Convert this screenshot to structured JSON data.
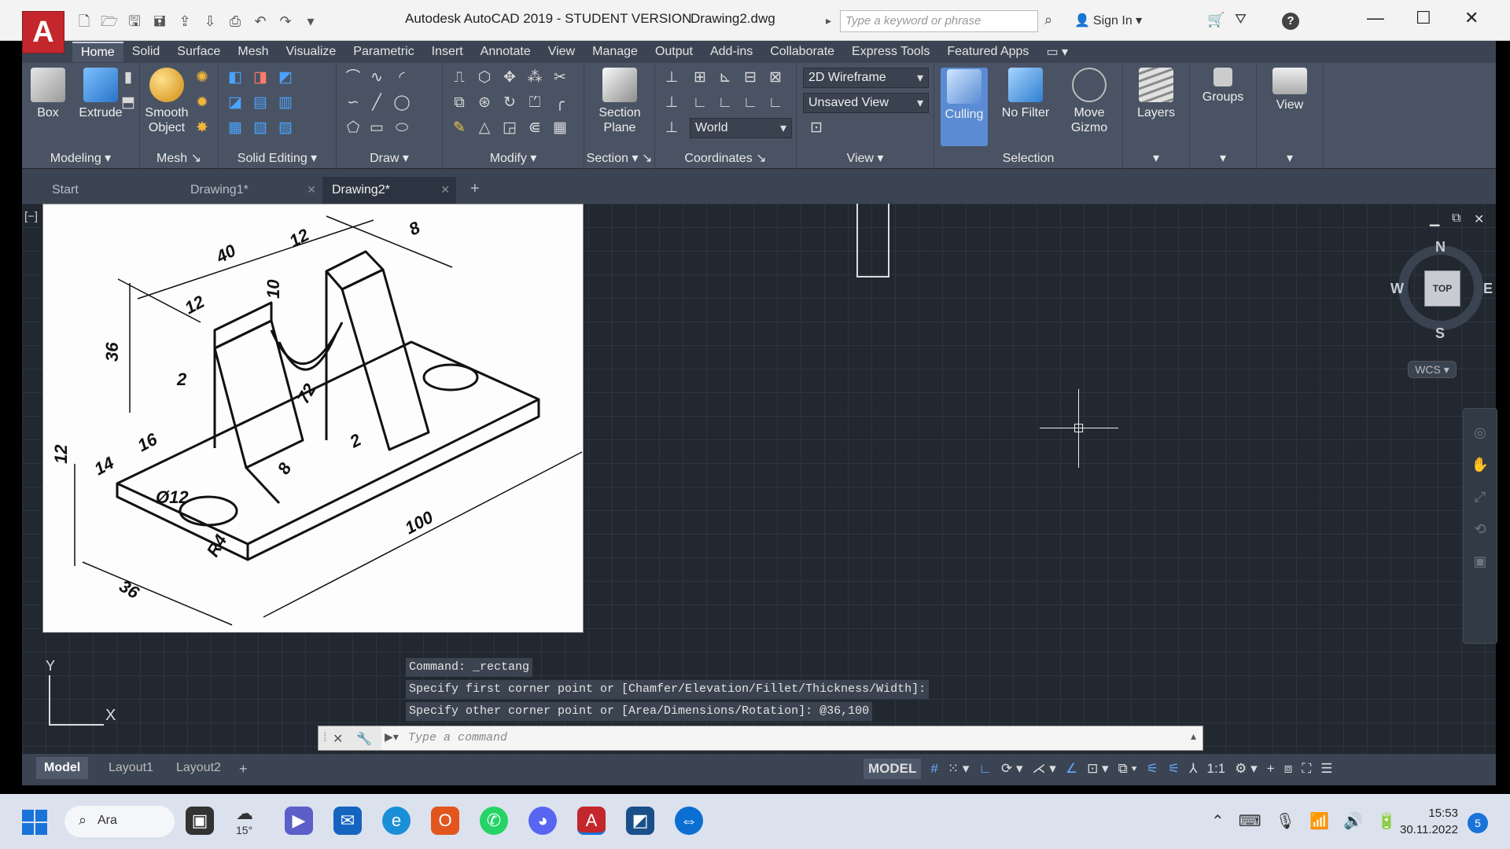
{
  "titlebar": {
    "app_title": "Autodesk AutoCAD 2019 - STUDENT VERSION",
    "file_title": "Drawing2.dwg",
    "search_placeholder": "Type a keyword or phrase",
    "sign_in": "Sign In",
    "logo_letter": "A"
  },
  "ribbon_tabs": [
    "Home",
    "Solid",
    "Surface",
    "Mesh",
    "Visualize",
    "Parametric",
    "Insert",
    "Annotate",
    "View",
    "Manage",
    "Output",
    "Add-ins",
    "Collaborate",
    "Express Tools",
    "Featured Apps"
  ],
  "ribbon": {
    "modeling": {
      "title": "Modeling",
      "box": "Box",
      "extrude": "Extrude"
    },
    "mesh": {
      "title": "Mesh",
      "smooth_object_1": "Smooth",
      "smooth_object_2": "Object"
    },
    "solid_editing": {
      "title": "Solid Editing"
    },
    "draw": {
      "title": "Draw"
    },
    "modify": {
      "title": "Modify"
    },
    "section": {
      "title": "Section",
      "section_plane_1": "Section",
      "section_plane_2": "Plane"
    },
    "coordinates": {
      "title": "Coordinates",
      "ucs_value": "World"
    },
    "view": {
      "title": "View",
      "visual_style": "2D Wireframe",
      "named_view": "Unsaved View"
    },
    "selection": {
      "title": "Selection",
      "culling": "Culling",
      "no_filter": "No Filter",
      "move_gizmo_1": "Move",
      "move_gizmo_2": "Gizmo"
    },
    "layers": "Layers",
    "groups": "Groups",
    "view_btn": "View"
  },
  "doc_tabs": [
    {
      "label": "Start"
    },
    {
      "label": "Drawing1*"
    },
    {
      "label": "Drawing2*"
    }
  ],
  "viewport": {
    "label": "[−]",
    "viewcube": {
      "top": "TOP",
      "n": "N",
      "s": "S",
      "e": "E",
      "w": "W"
    },
    "wcs": "WCS",
    "ucs": {
      "x": "X",
      "y": "Y"
    }
  },
  "reference_drawing": {
    "dims": {
      "d40": "40",
      "d12a": "12",
      "d8": "8",
      "d12b": "12",
      "d10": "10",
      "d36a": "36",
      "d2a": "2",
      "d72": "72",
      "d2b": "2",
      "d16": "16",
      "d14": "14",
      "d12c": "12",
      "d8b": "8",
      "dia12": "Ø12",
      "r24": "R4",
      "d100": "100",
      "d36b": "36"
    }
  },
  "command": {
    "history": [
      "Command: _rectang",
      "Specify first corner point or [Chamfer/Elevation/Fillet/Thickness/Width]:",
      "Specify other corner point or [Area/Dimensions/Rotation]: @36,100"
    ],
    "placeholder": "Type a command"
  },
  "layout_tabs": [
    "Model",
    "Layout1",
    "Layout2"
  ],
  "status": {
    "model": "MODEL",
    "scale": "1:1"
  },
  "taskbar": {
    "search": "Ara",
    "weather": "15°",
    "time": "15:53",
    "date": "30.11.2022",
    "notifications": "5"
  },
  "colors": {
    "autocad_red": "#c3272c",
    "ribbon_bg": "#4a5363",
    "canvas_bg": "#212830",
    "accent_blue": "#68a9ff"
  }
}
